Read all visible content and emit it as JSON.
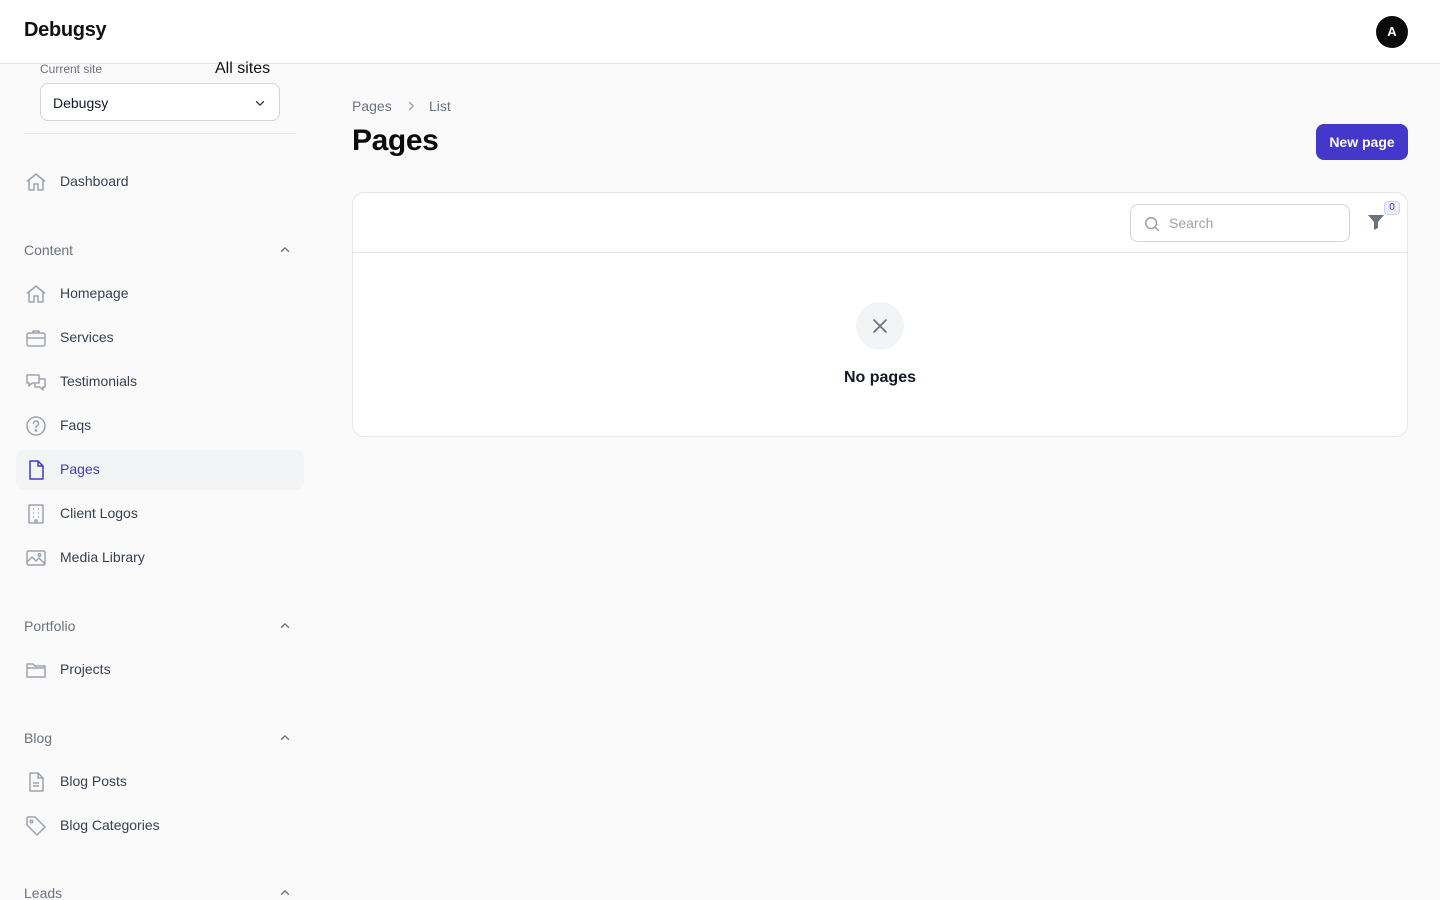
{
  "app": {
    "brand": "Debugsy",
    "avatar_initial": "A"
  },
  "site_switcher": {
    "label": "Current site",
    "all_sites": "All sites",
    "selected": "Debugsy"
  },
  "nav": {
    "dashboard": "Dashboard",
    "groups": [
      {
        "label": "Content",
        "items": [
          "Homepage",
          "Services",
          "Testimonials",
          "Faqs",
          "Pages",
          "Client Logos",
          "Media Library"
        ]
      },
      {
        "label": "Portfolio",
        "items": [
          "Projects"
        ]
      },
      {
        "label": "Blog",
        "items": [
          "Blog Posts",
          "Blog Categories"
        ]
      },
      {
        "label": "Leads",
        "items": []
      }
    ],
    "active": "Pages"
  },
  "breadcrumb": [
    "Pages",
    "List"
  ],
  "page": {
    "title": "Pages",
    "new_button": "New page"
  },
  "table": {
    "search_placeholder": "Search",
    "filter_count": "0",
    "empty_state": "No pages"
  },
  "colors": {
    "accent": "#4338ca",
    "sidebar_active_bg": "#f3f4f6",
    "page_bg": "#fafafa"
  },
  "icons": {
    "dashboard": "home-icon",
    "homepage": "home-icon",
    "services": "briefcase-icon",
    "testimonials": "chat-bubbles-icon",
    "faqs": "question-circle-icon",
    "pages": "document-icon",
    "client_logos": "building-icon",
    "media_library": "photo-icon",
    "projects": "folder-icon",
    "blog_posts": "document-text-icon",
    "blog_categories": "tag-icon"
  }
}
